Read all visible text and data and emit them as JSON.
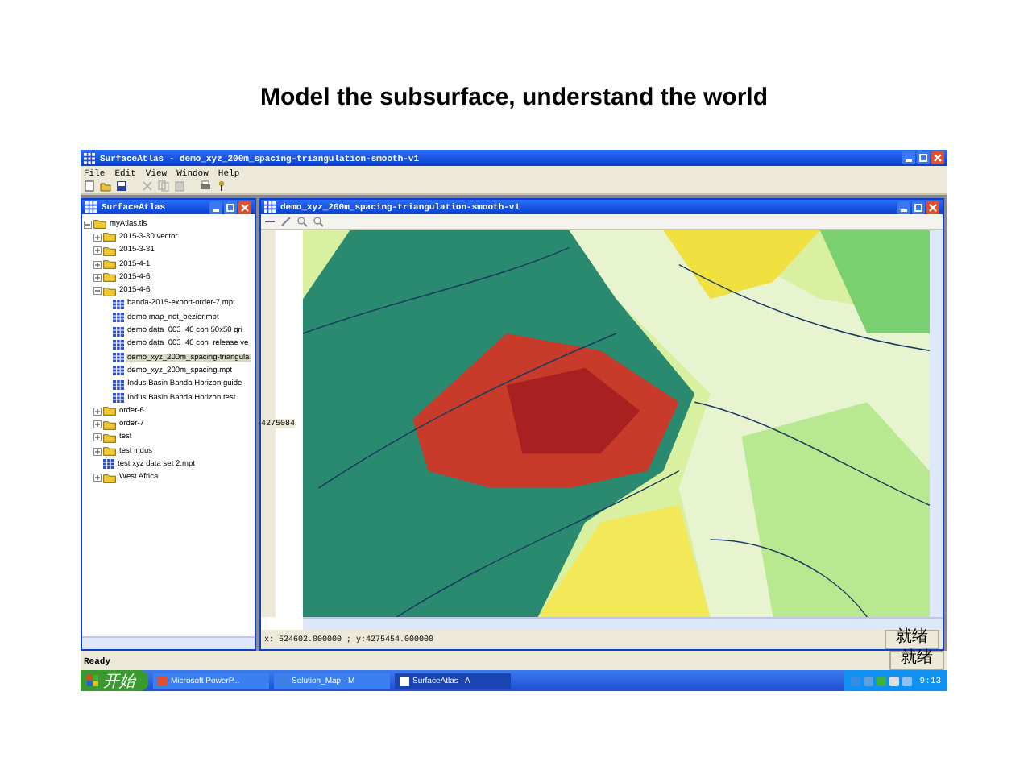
{
  "heading": "Model the subsurface, understand the world",
  "app": {
    "title": "SurfaceAtlas - demo_xyz_200m_spacing-triangulation-smooth-v1",
    "menu": [
      "File",
      "Edit",
      "View",
      "Window",
      "Help"
    ]
  },
  "explorer": {
    "title": "SurfaceAtlas",
    "tree": [
      {
        "label": "myAtlas.tls",
        "kind": "folder",
        "expanded": true,
        "selected": false,
        "children": [
          {
            "label": "2015-3-30 vector",
            "kind": "folder",
            "expanded": false,
            "selected": false
          },
          {
            "label": "2015-3-31",
            "kind": "folder",
            "expanded": false,
            "selected": false
          },
          {
            "label": "2015-4-1",
            "kind": "folder",
            "expanded": false,
            "selected": false
          },
          {
            "label": "2015-4-6",
            "kind": "folder",
            "expanded": false,
            "selected": false
          },
          {
            "label": "2015-4-6",
            "kind": "folder",
            "expanded": true,
            "selected": false,
            "children": [
              {
                "label": "banda-2015-export-order-7.mpt",
                "kind": "file",
                "selected": false
              },
              {
                "label": "demo  map_not_bezier.mpt",
                "kind": "file",
                "selected": false
              },
              {
                "label": "demo data_003_40 con 50x50 gri",
                "kind": "file",
                "selected": false
              },
              {
                "label": "demo data_003_40 con_release ve",
                "kind": "file",
                "selected": false
              },
              {
                "label": "demo_xyz_200m_spacing-triangula",
                "kind": "file",
                "selected": true
              },
              {
                "label": "demo_xyz_200m_spacing.mpt",
                "kind": "file",
                "selected": false
              },
              {
                "label": "Indus Basin Banda Horizon guide",
                "kind": "file",
                "selected": false
              },
              {
                "label": "Indus Basin Banda Horizon test",
                "kind": "file",
                "selected": false
              }
            ]
          },
          {
            "label": "order-6",
            "kind": "folder",
            "expanded": false,
            "selected": false
          },
          {
            "label": "order-7",
            "kind": "folder",
            "expanded": false,
            "selected": false
          },
          {
            "label": "test",
            "kind": "folder",
            "expanded": false,
            "selected": false
          },
          {
            "label": "test indus",
            "kind": "folder",
            "expanded": false,
            "selected": false
          },
          {
            "label": "test xyz data set 2.mpt",
            "kind": "file",
            "selected": false
          },
          {
            "label": "West Africa",
            "kind": "folder",
            "expanded": false,
            "selected": false
          }
        ]
      }
    ]
  },
  "document": {
    "title": "demo_xyz_200m_spacing-triangulation-smooth-v1",
    "axis_label": "4275084",
    "coordinates": "x: 524602.000000 ; y:4275454.000000",
    "status_panel": "就绪"
  },
  "status_bar": {
    "text": "Ready",
    "panel": "就绪"
  },
  "taskbar": {
    "start": "开始",
    "tasks": [
      {
        "label": "Microsoft PowerP...",
        "selected": false
      },
      {
        "label": "Solution_Map - M",
        "selected": false
      },
      {
        "label": "SurfaceAtlas - A",
        "selected": true
      }
    ],
    "clock": "9:13"
  }
}
